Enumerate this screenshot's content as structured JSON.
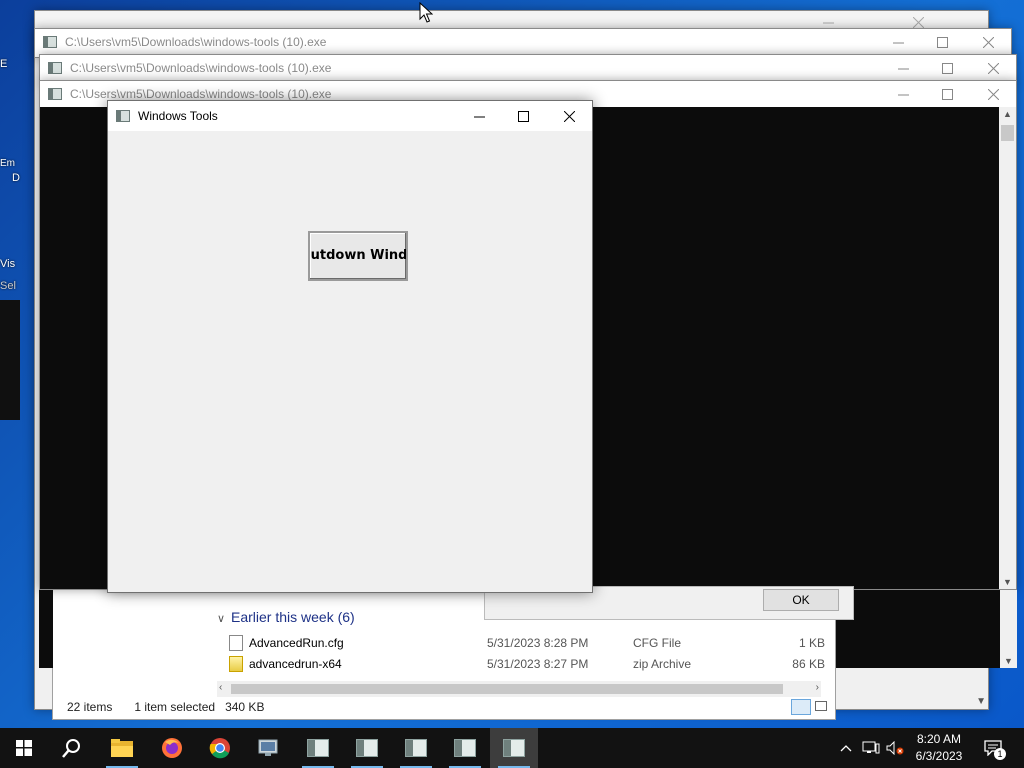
{
  "desktop": {
    "icon_fragments": [
      "E",
      "Em",
      "D",
      "Vis",
      "Sel"
    ]
  },
  "console_windows": [
    {
      "title": "C:\\Users\\vm5\\Downloads\\windows-tools (10).exe"
    },
    {
      "title": "C:\\Users\\vm5\\Downloads\\windows-tools (10).exe"
    },
    {
      "title": "C:\\Users\\vm5\\Downloads\\windows-tools (10).exe"
    }
  ],
  "explorer": {
    "group_header": "Earlier this week (6)",
    "files": [
      {
        "name": "AdvancedRun.cfg",
        "date": "5/31/2023 8:28 PM",
        "type": "CFG File",
        "size": "1 KB",
        "icon": "cfg-file-icon"
      },
      {
        "name": "advancedrun-x64",
        "date": "5/31/2023 8:27 PM",
        "type": "zip Archive",
        "size": "86 KB",
        "icon": "zip-archive-icon"
      }
    ],
    "status": {
      "items": "22 items",
      "selected": "1 item selected",
      "size": "340 KB"
    }
  },
  "message_box": {
    "ok_label": "OK"
  },
  "tool_window": {
    "title": "Windows Tools",
    "button_label": "Shutdown Windows"
  },
  "taskbar": {
    "apps": [
      "start-icon",
      "search-icon",
      "file-explorer-icon",
      "firefox-icon",
      "chrome-icon",
      "control-panel-icon",
      "console-app-icon",
      "console-app-icon",
      "console-app-icon",
      "console-app-icon",
      "windows-tools-icon"
    ],
    "clock_time": "8:20 AM",
    "clock_date": "6/3/2023",
    "notification_count": "1"
  },
  "colors": {
    "accent": "#76b9ed",
    "taskbar": "#121212",
    "console": "#0c0c0c",
    "window_face": "#f0f0f0"
  }
}
